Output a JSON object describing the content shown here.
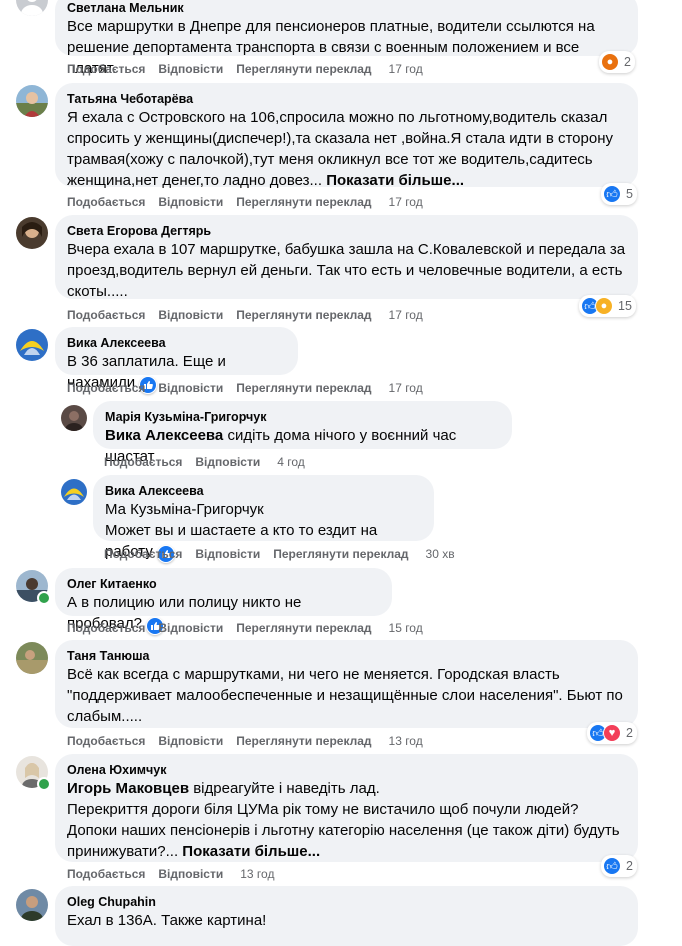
{
  "comments": [
    {
      "author": "Светлана Мельник",
      "text": "Все маршрутки в Днепре для пенсионеров платные, водители ссылются на решение депортамента транспорта в связи с военным положением и все платят.",
      "actions": {
        "like": "Подобається",
        "reply": "Відповісти",
        "translate": "Переглянути переклад",
        "time": "17 год"
      },
      "reactions": {
        "icons": [
          "angry-reaction-icon"
        ],
        "count": "2"
      }
    },
    {
      "author": "Татьяна Чеботарёва",
      "text": "Я ехала с Островского на 106,спросила можно по льготному,водитель сказал спросить у женщины(диспечер!),та сказала нет ,война.Я стала идти в сторону трамвая(хожу с палочкой),тут меня окликнул все тот же водитель,садитесь женщина,нет денег,то ладно довез...",
      "more": "Показати більше...",
      "actions": {
        "like": "Подобається",
        "reply": "Відповісти",
        "translate": "Переглянути переклад",
        "time": "17 год"
      },
      "reactions": {
        "icons": [
          "like-reaction-icon"
        ],
        "count": "5"
      }
    },
    {
      "author": "Света Егорова Дегтярь",
      "text": "Вчера ехала в 107 маршрутке, бабушка зашла на С.Ковалевской и передала за проезд,водитель вернул ей деньги. Так что есть и человечные водители, а есть скоты.....",
      "actions": {
        "like": "Подобається",
        "reply": "Відповісти",
        "translate": "Переглянути переклад",
        "time": "17 год"
      },
      "reactions": {
        "icons": [
          "like-reaction-icon",
          "haha-reaction-icon"
        ],
        "count": "15"
      }
    },
    {
      "author": "Вика Алексеева",
      "text": "В 36 заплатила. Еще и нахамили",
      "actions": {
        "like": "Подобається",
        "reply": "Відповісти",
        "translate": "Переглянути переклад",
        "time": "17 год"
      }
    },
    {
      "author": "Марія Кузьміна-Григорчук",
      "mention": "Вика Алексеева",
      "text": " сидіть дома нічого у воєнний час шастат",
      "actions": {
        "like": "Подобається",
        "reply": "Відповісти",
        "time": "4 год"
      }
    },
    {
      "author": "Вика Алексеева",
      "text": "Ма Кузьміна-Григорчук\nМожет вы и шастаете а кто то ездит на работу",
      "actions": {
        "like": "Подобається",
        "reply": "Відповісти",
        "translate": "Переглянути переклад",
        "time": "30 хв"
      }
    },
    {
      "author": "Олег Китаенко",
      "text": "А в полицию или полицу никто не пробовал?",
      "actions": {
        "like": "Подобається",
        "reply": "Відповісти",
        "translate": "Переглянути переклад",
        "time": "15 год"
      }
    },
    {
      "author": "Таня Танюша",
      "text": "Всё как всегда с маршрутками, ни чего не меняется. Городская власть \"поддерживает малообеспеченные и незащищённые слои населения\". Бьют по слабым.....",
      "actions": {
        "like": "Подобається",
        "reply": "Відповісти",
        "translate": "Переглянути переклад",
        "time": "13 год"
      },
      "reactions": {
        "icons": [
          "like-reaction-icon",
          "heart-reaction-icon"
        ],
        "count": "2"
      }
    },
    {
      "author": "Олена Юхимчук",
      "mention": "Игорь Маковцев",
      "text": " відреагуйте і наведіть лад.\nПерекриття дороги біля ЦУМа рік тому не вистачило щоб почули людей?\nДопоки наших пенсіонерів і льготну категорію населення (це також діти) будуть принижувати?...",
      "more": "Показати більше...",
      "actions": {
        "like": "Подобається",
        "reply": "Відповісти",
        "time": "13 год"
      },
      "reactions": {
        "icons": [
          "like-reaction-icon"
        ],
        "count": "2"
      }
    },
    {
      "author": "Oleg Chupahin",
      "text": "Ехал в 136А. Также картина!"
    }
  ]
}
